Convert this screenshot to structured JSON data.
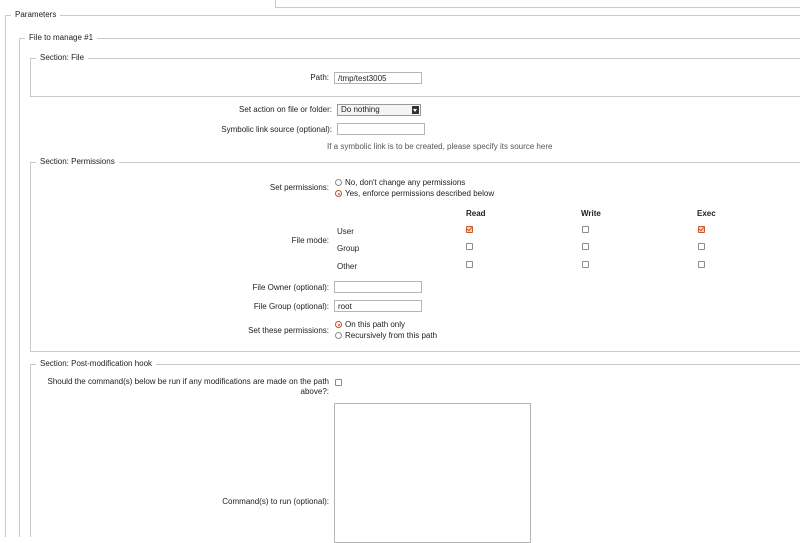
{
  "fieldsets": {
    "parameters": "Parameters",
    "file_to_manage": "File to manage #1",
    "section_file": "Section: File",
    "section_permissions": "Section: Permissions",
    "section_hook": "Section: Post-modification hook"
  },
  "file": {
    "path_label": "Path:",
    "path_value": "/tmp/test3005"
  },
  "action": {
    "label": "Set action on file or folder:",
    "selected": "Do nothing"
  },
  "symlink": {
    "label": "Symbolic link source (optional):",
    "value": "",
    "help": "If a symbolic link is to be created, please specify its source here"
  },
  "permissions": {
    "set_label": "Set permissions:",
    "option_no": "No, don't change any permissions",
    "option_yes": "Yes, enforce permissions described below",
    "selected": "yes",
    "file_mode_label": "File mode:",
    "columns": [
      "Read",
      "Write",
      "Exec"
    ],
    "rows": [
      {
        "name": "User",
        "read": true,
        "write": false,
        "exec": true
      },
      {
        "name": "Group",
        "read": false,
        "write": false,
        "exec": false
      },
      {
        "name": "Other",
        "read": false,
        "write": false,
        "exec": false
      }
    ],
    "owner_label": "File Owner (optional):",
    "owner_value": "",
    "group_label": "File Group (optional):",
    "group_value": "root",
    "scope_label": "Set these permissions:",
    "scope_this": "On this path only",
    "scope_recursive": "Recursively from this path",
    "scope_selected": "this"
  },
  "hook": {
    "run_if_modified_label_1": "Should the command(s) below be run if any modifications are made on the path",
    "run_if_modified_label_2": "above?:",
    "run_if_modified": false,
    "command_label": "Command(s) to run (optional):",
    "command_value": ""
  }
}
